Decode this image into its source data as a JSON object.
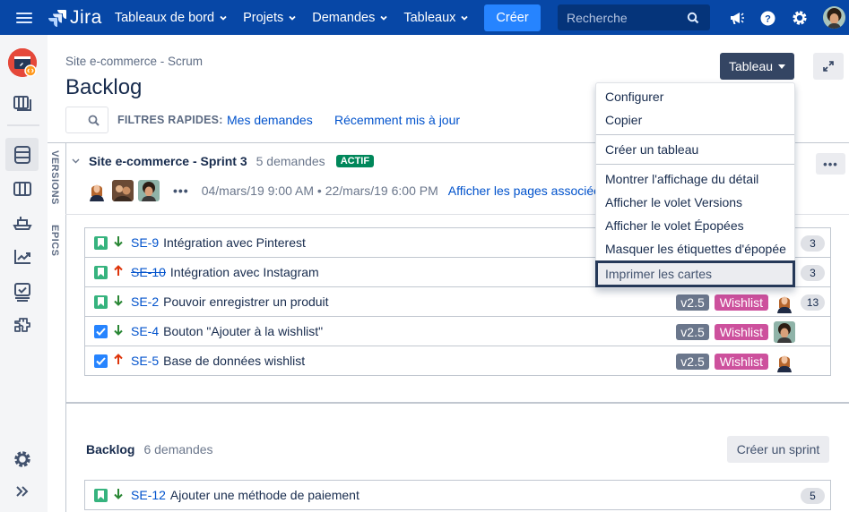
{
  "topnav": {
    "app_name": "Jira",
    "items": [
      {
        "label": "Tableaux de bord"
      },
      {
        "label": "Projets"
      },
      {
        "label": "Demandes"
      },
      {
        "label": "Tableaux"
      }
    ],
    "create_label": "Créer",
    "search_placeholder": "Recherche",
    "icons": [
      "notifications-megaphone-icon",
      "help-icon",
      "settings-icon",
      "profile-avatar"
    ]
  },
  "sidebar": {
    "items": [
      {
        "name": "project-avatar"
      },
      {
        "name": "boards-icon"
      },
      {
        "name": "backlog-icon",
        "active": true
      },
      {
        "name": "active-sprint-icon"
      },
      {
        "name": "releases-icon"
      },
      {
        "name": "reports-icon"
      },
      {
        "name": "issues-icon"
      },
      {
        "name": "add-ons-icon"
      },
      {
        "name": "project-settings-icon"
      },
      {
        "name": "expand-sidebar-icon"
      }
    ]
  },
  "header": {
    "breadcrumb": "Site e-commerce - Scrum",
    "title": "Backlog",
    "quick_filters_label": "FILTRES RAPIDES:",
    "quick_filters": [
      "Mes demandes",
      "Récemment mis à jour"
    ],
    "board_button": "Tableau"
  },
  "side_tabs": {
    "versions": "VERSIONS",
    "epics": "EPICS"
  },
  "sprint": {
    "name": "Site e-commerce - Sprint 3",
    "count": "5 demandes",
    "status": "ACTIF",
    "dates": "04/mars/19 9:00 AM • 22/mars/19 6:00 PM",
    "pages_link": "Afficher les pages associées",
    "issues": [
      {
        "type": "story",
        "priority": "low",
        "key": "SE-9",
        "summary": "Intégration avec Pinterest",
        "done": false,
        "version": "",
        "epic": "",
        "assignee": "avatar-2",
        "estimate": "3"
      },
      {
        "type": "story",
        "priority": "high",
        "key": "SE-10",
        "summary": "Intégration avec Instagram",
        "done": true,
        "version": "",
        "epic": "",
        "assignee": "",
        "estimate": "3"
      },
      {
        "type": "story",
        "priority": "low",
        "key": "SE-2",
        "summary": "Pouvoir enregistrer un produit",
        "done": false,
        "version": "v2.5",
        "epic": "Wishlist",
        "assignee": "avatar-1",
        "estimate": "13"
      },
      {
        "type": "task",
        "priority": "low",
        "key": "SE-4",
        "summary": "Bouton \"Ajouter à la wishlist\"",
        "done": false,
        "version": "v2.5",
        "epic": "Wishlist",
        "assignee": "avatar-3",
        "estimate": ""
      },
      {
        "type": "task",
        "priority": "high",
        "key": "SE-5",
        "summary": "Base de données wishlist",
        "done": false,
        "version": "v2.5",
        "epic": "Wishlist",
        "assignee": "avatar-1",
        "estimate": ""
      }
    ]
  },
  "backlog": {
    "name": "Backlog",
    "count": "6 demandes",
    "create_sprint": "Créer un sprint",
    "issues": [
      {
        "type": "story",
        "priority": "low",
        "key": "SE-12",
        "summary": "Ajouter une méthode de paiement",
        "done": false,
        "version": "",
        "epic": "",
        "assignee": "",
        "estimate": "5"
      }
    ]
  },
  "board_menu": {
    "groups": [
      [
        "Configurer",
        "Copier"
      ],
      [
        "Créer un tableau"
      ],
      [
        "Montrer l'affichage du détail",
        "Afficher le volet Versions",
        "Afficher le volet Épopées",
        "Masquer les étiquettes d'épopée",
        "Imprimer les cartes"
      ]
    ],
    "focused_item": "Imprimer les cartes"
  },
  "colors": {
    "nav_bg": "#0747a6",
    "create_btn": "#2684ff",
    "active_lozenge": "#00875a",
    "epic_wishlist": "#cd519d",
    "version_badge": "#6b778c",
    "link": "#0052cc"
  }
}
